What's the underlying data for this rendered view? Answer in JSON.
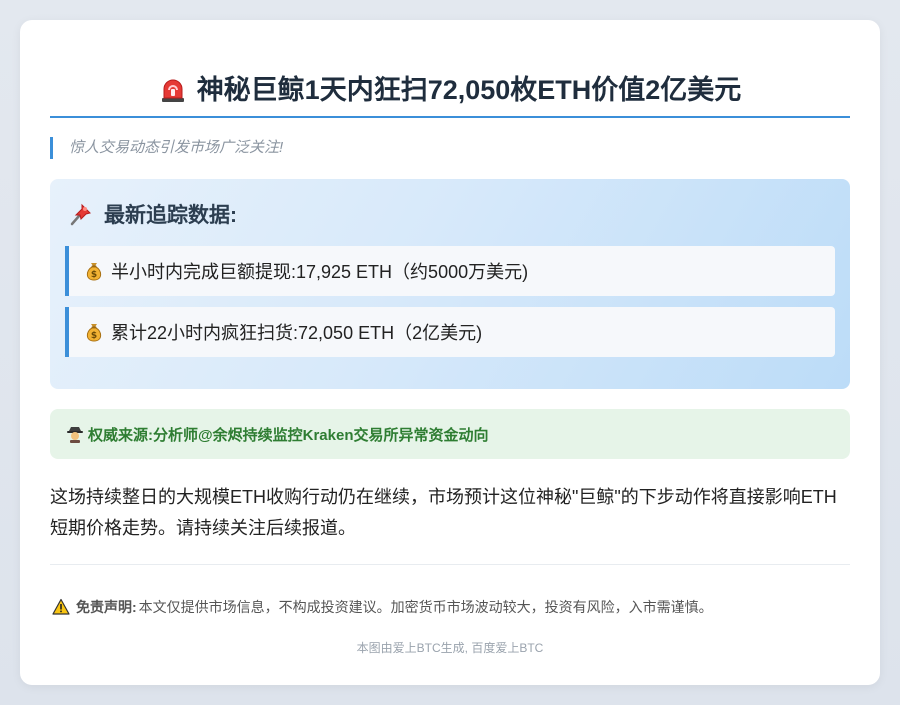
{
  "header": {
    "title": "神秘巨鲸1天内狂扫72,050枚ETH价值2亿美元",
    "title_icon": "siren-icon"
  },
  "subtitle": "惊人交易动态引发市场广泛关注!",
  "tracking": {
    "heading": "最新追踪数据:",
    "heading_icon": "pushpin-icon",
    "items": [
      {
        "icon": "money-bag-icon",
        "text": "半小时内完成巨额提现:17,925 ETH（约5000万美元)"
      },
      {
        "icon": "money-bag-icon",
        "text": "累计22小时内疯狂扫货:72,050 ETH（2亿美元)"
      }
    ]
  },
  "source": {
    "icon": "detective-icon",
    "text": "权威来源:分析师@余烬持续监控Kraken交易所异常资金动向"
  },
  "body": "这场持续整日的大规模ETH收购行动仍在继续，市场预计这位神秘\"巨鲸\"的下步动作将直接影响ETH短期价格走势。请持续关注后续报道。",
  "disclaimer": {
    "icon": "warning-icon",
    "label": "免责声明:",
    "text": "本文仅提供市场信息，不构成投资建议。加密货币市场波动较大，投资有风险，入市需谨慎。"
  },
  "footer": "本图由爱上BTC生成, 百度爱上BTC",
  "colors": {
    "accent": "#3b8fd9",
    "source_text": "#2e7d32",
    "source_bg": "#e6f4e8"
  }
}
